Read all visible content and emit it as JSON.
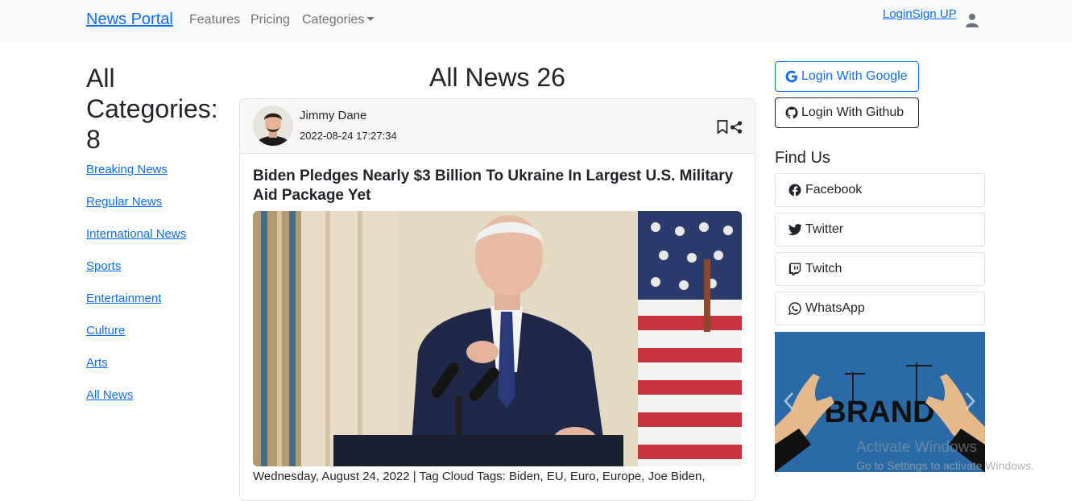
{
  "navbar": {
    "brand": "News Portal",
    "features": "Features",
    "pricing": "Pricing",
    "categories": "Categories",
    "login": "LoginSign UP"
  },
  "sidebar": {
    "heading": "All Categories: 8",
    "items": [
      "Breaking News",
      "Regular News",
      "International News",
      "Sports",
      "Entertainment",
      "Culture",
      "Arts",
      "All News"
    ]
  },
  "main": {
    "heading": "All News 26",
    "article": {
      "author": "Jimmy Dane",
      "date": "2022-08-24 17:27:34",
      "title": "Biden Pledges Nearly $3 Billion To Ukraine In Largest U.S. Military Aid Package Yet",
      "meta": "Wednesday, August 24, 2022 | Tag Cloud Tags: Biden, EU, Euro, Europe, Joe Biden,"
    }
  },
  "right": {
    "google_button": "Login With Google",
    "github_button": "Login With Github",
    "find_heading": "Find Us",
    "social": [
      "Facebook",
      "Twitter",
      "Twitch",
      "WhatsApp"
    ],
    "carousel_text": "BRAND"
  },
  "watermark": {
    "title": "Activate Windows",
    "subtitle": "Go to Settings to activate Windows."
  },
  "colors": {
    "link": "#0d6efd",
    "navbar_bg": "#f8f9fa",
    "carousel_bg": "#2a6aa6"
  },
  "icons": {
    "user": "user-icon",
    "bookmark": "bookmark-icon",
    "share": "share-icon",
    "google": "google-icon",
    "github": "github-icon",
    "facebook": "facebook-icon",
    "twitter": "twitter-icon",
    "twitch": "twitch-icon",
    "whatsapp": "whatsapp-icon"
  }
}
